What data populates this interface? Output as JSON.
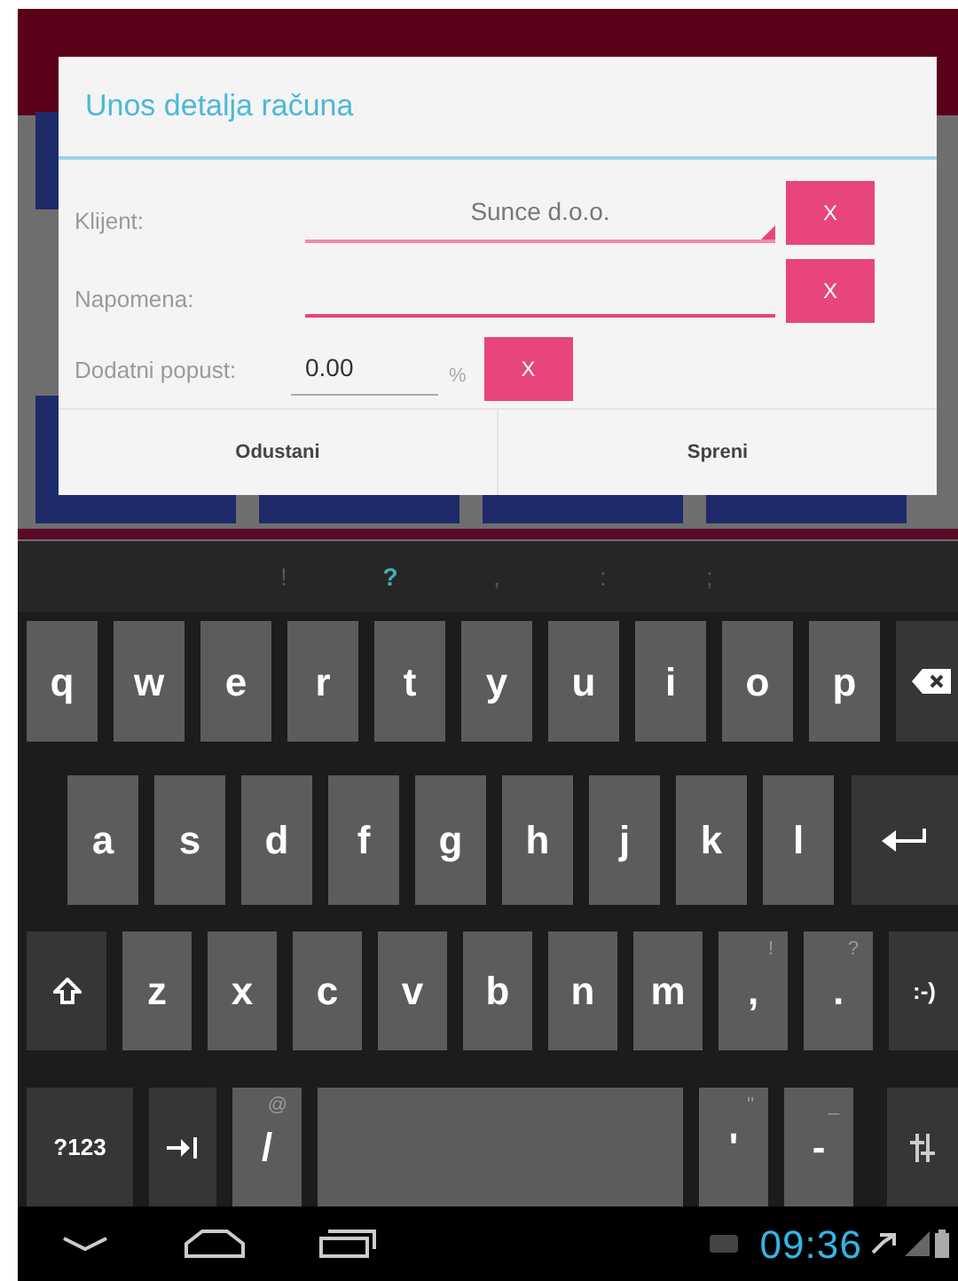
{
  "dialog": {
    "title": "Unos detalja računa",
    "fields": [
      {
        "kind": "dropdown",
        "label": "Klijent:",
        "value": "Sunce d.o.o.",
        "clear_label": "X"
      },
      {
        "kind": "text",
        "label": "Napomena:",
        "clear_label": "X"
      }
    ],
    "discount": {
      "label": "Dodatni popust:",
      "value": "0.00",
      "unit": "%",
      "clear_label": "X"
    },
    "buttons": [
      "Odustani",
      "Spreni"
    ]
  },
  "keyboard": {
    "suggestions": [
      {
        "text": "!",
        "selected": false
      },
      {
        "text": "?",
        "selected": true
      },
      {
        "text": ",",
        "selected": false
      },
      {
        "text": ":",
        "selected": false
      },
      {
        "text": ";",
        "selected": false
      }
    ],
    "rows": [
      [
        {
          "kind": "char",
          "label": "q"
        },
        {
          "kind": "char",
          "label": "w"
        },
        {
          "kind": "char",
          "label": "e"
        },
        {
          "kind": "char",
          "label": "r"
        },
        {
          "kind": "char",
          "label": "t"
        },
        {
          "kind": "char",
          "label": "y"
        },
        {
          "kind": "char",
          "label": "u"
        },
        {
          "kind": "char",
          "label": "i"
        },
        {
          "kind": "char",
          "label": "o"
        },
        {
          "kind": "char",
          "label": "p"
        },
        {
          "kind": "backspace"
        }
      ],
      [
        {
          "kind": "char",
          "label": "a"
        },
        {
          "kind": "char",
          "label": "s"
        },
        {
          "kind": "char",
          "label": "d"
        },
        {
          "kind": "char",
          "label": "f"
        },
        {
          "kind": "char",
          "label": "g"
        },
        {
          "kind": "char",
          "label": "h"
        },
        {
          "kind": "char",
          "label": "j"
        },
        {
          "kind": "char",
          "label": "k"
        },
        {
          "kind": "char",
          "label": "l"
        },
        {
          "kind": "enter"
        }
      ],
      [
        {
          "kind": "shift"
        },
        {
          "kind": "char",
          "label": "z"
        },
        {
          "kind": "char",
          "label": "x"
        },
        {
          "kind": "char",
          "label": "c"
        },
        {
          "kind": "char",
          "label": "v"
        },
        {
          "kind": "char",
          "label": "b"
        },
        {
          "kind": "char",
          "label": "n"
        },
        {
          "kind": "char",
          "label": "m"
        },
        {
          "kind": "char",
          "label": ",",
          "hint": "!"
        },
        {
          "kind": "char",
          "label": ".",
          "hint": "?"
        },
        {
          "kind": "smiley",
          "label": ":-)"
        }
      ],
      [
        {
          "kind": "symbols",
          "label": "?123"
        },
        {
          "kind": "tab"
        },
        {
          "kind": "char",
          "label": "/",
          "hint": "@"
        },
        {
          "kind": "space"
        },
        {
          "kind": "char",
          "label": "'",
          "hint": "\""
        },
        {
          "kind": "char",
          "label": "-",
          "hint": "_"
        },
        {
          "kind": "settings"
        }
      ]
    ]
  },
  "status_bar": {
    "time": "09:36"
  }
}
